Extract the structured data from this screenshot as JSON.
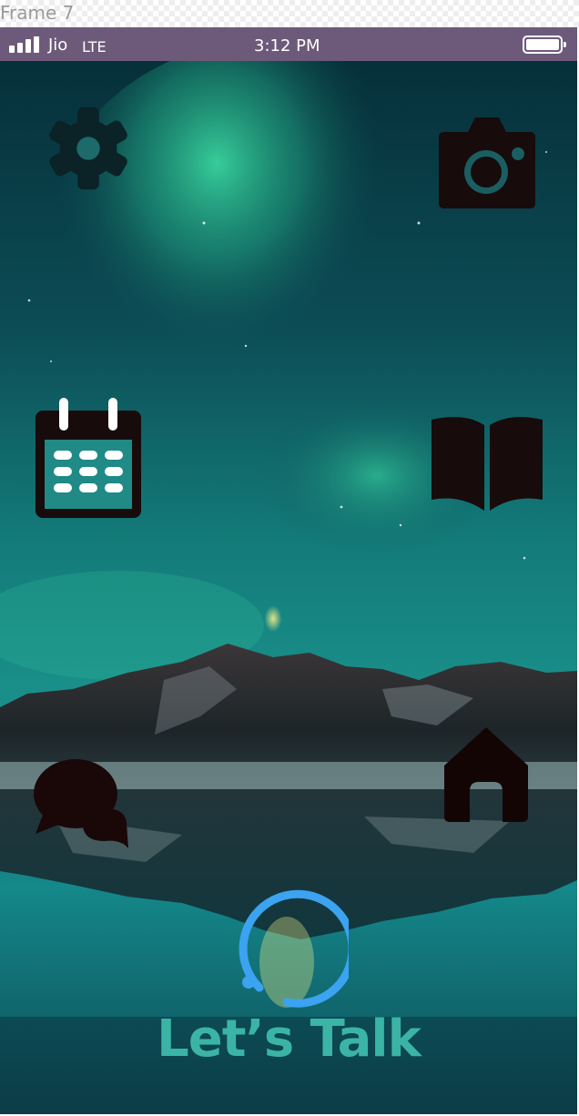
{
  "frame": {
    "label": "Frame 7"
  },
  "status_bar": {
    "carrier": "Jio",
    "network": "LTE",
    "time": "3:12 PM",
    "background": "#6d5a7a"
  },
  "home_icons": [
    {
      "name": "settings",
      "icon": "gear-icon"
    },
    {
      "name": "camera",
      "icon": "camera-icon"
    },
    {
      "name": "calendar",
      "icon": "calendar-icon"
    },
    {
      "name": "book",
      "icon": "open-book-icon"
    },
    {
      "name": "chat",
      "icon": "chat-bubbles-icon"
    },
    {
      "name": "home",
      "icon": "home-icon"
    }
  ],
  "assistant": {
    "cta_label": "Let’s Talk",
    "indicator": "loading-ring-icon",
    "accent_color": "#3ba3f0",
    "label_color": "#3bb4a6"
  }
}
